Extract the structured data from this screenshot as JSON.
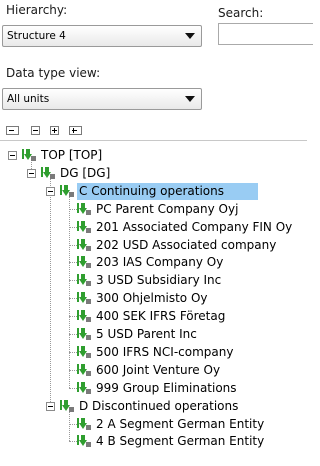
{
  "hierarchy": {
    "label": "Hierarchy:",
    "selected": "Structure 4"
  },
  "search": {
    "label": "Search:",
    "value": ""
  },
  "datatype": {
    "label": "Data type view:",
    "selected": "All units"
  },
  "toolbar": {
    "buttons": [
      "collapse-all-icon",
      "collapse-icon",
      "expand-icon",
      "expand-all-icon"
    ]
  },
  "tree": [
    {
      "label": "TOP [TOP]",
      "level": 0,
      "expander": true
    },
    {
      "label": "DG [DG]",
      "level": 1,
      "expander": true
    },
    {
      "label": "C Continuing operations",
      "level": 2,
      "expander": true,
      "selected": true
    },
    {
      "label": "PC Parent Company Oyj",
      "level": 3
    },
    {
      "label": "201 Associated Company FIN Oy",
      "level": 3
    },
    {
      "label": "202 USD Associated company",
      "level": 3
    },
    {
      "label": "203 IAS Company Oy",
      "level": 3
    },
    {
      "label": "3 USD Subsidiary Inc",
      "level": 3
    },
    {
      "label": "300 Ohjelmisto Oy",
      "level": 3
    },
    {
      "label": "400 SEK IFRS Företag",
      "level": 3
    },
    {
      "label": "5 USD Parent Inc",
      "level": 3
    },
    {
      "label": "500 IFRS NCI-company",
      "level": 3
    },
    {
      "label": "600 Joint Venture Oy",
      "level": 3
    },
    {
      "label": "999 Group Eliminations",
      "level": 3
    },
    {
      "label": "D Discontinued operations",
      "level": 2,
      "expander": true
    },
    {
      "label": "2 A Segment German Entity",
      "level": 3
    },
    {
      "label": "4 B Segment German Entity",
      "level": 3
    }
  ],
  "colors": {
    "selection": "#99ccf3",
    "arrow_green": "#2f9e2f"
  }
}
